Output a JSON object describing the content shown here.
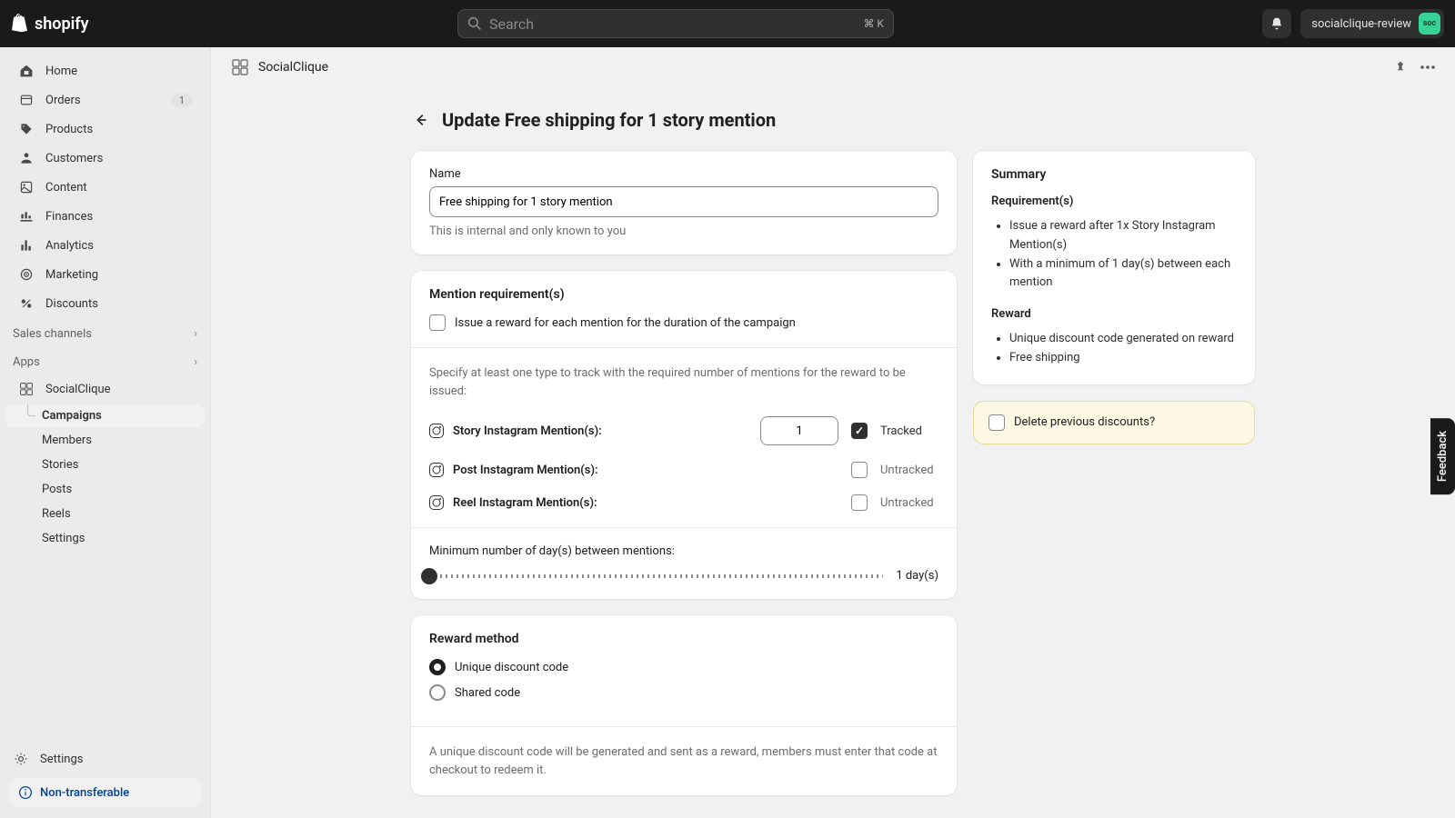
{
  "topbar": {
    "logo_text": "shopify",
    "search_placeholder": "Search",
    "search_shortcut": "⌘ K",
    "account_name": "socialclique-review",
    "avatar_initials": "soc"
  },
  "sidebar": {
    "items": [
      {
        "label": "Home",
        "icon": "home-icon"
      },
      {
        "label": "Orders",
        "icon": "orders-icon",
        "badge": "1"
      },
      {
        "label": "Products",
        "icon": "products-icon"
      },
      {
        "label": "Customers",
        "icon": "customers-icon"
      },
      {
        "label": "Content",
        "icon": "content-icon"
      },
      {
        "label": "Finances",
        "icon": "finances-icon"
      },
      {
        "label": "Analytics",
        "icon": "analytics-icon"
      },
      {
        "label": "Marketing",
        "icon": "marketing-icon"
      },
      {
        "label": "Discounts",
        "icon": "discounts-icon"
      }
    ],
    "sales_channels_label": "Sales channels",
    "apps_label": "Apps",
    "app_name": "SocialClique",
    "app_subitems": [
      "Campaigns",
      "Members",
      "Stories",
      "Posts",
      "Reels",
      "Settings"
    ],
    "settings_label": "Settings",
    "nontransferable_label": "Non-transferable"
  },
  "appbar": {
    "title": "SocialClique"
  },
  "page": {
    "title": "Update Free shipping for 1 story mention",
    "name_section": {
      "label": "Name",
      "value": "Free shipping for 1 story mention",
      "help": "This is internal and only known to you"
    },
    "mention_section": {
      "title": "Mention requirement(s)",
      "each_mention_label": "Issue a reward for each mention for the duration of the campaign",
      "specify_text": "Specify at least one type to track with the required number of mentions for the reward to be issued:",
      "story_label": "Story Instagram Mention(s):",
      "story_value": "1",
      "post_label": "Post Instagram Mention(s):",
      "reel_label": "Reel Instagram Mention(s):",
      "tracked_label": "Tracked",
      "untracked_label": "Untracked",
      "slider_label": "Minimum number of day(s) between mentions:",
      "slider_value": "1 day(s)"
    },
    "reward_section": {
      "title": "Reward method",
      "unique_label": "Unique discount code",
      "shared_label": "Shared code",
      "desc": "A unique discount code will be generated and sent as a reward, members must enter that code at checkout to redeem it."
    },
    "summary": {
      "title": "Summary",
      "req_label": "Requirement(s)",
      "req_items": [
        "Issue a reward after 1x Story Instagram Mention(s)",
        "With a minimum of 1 day(s) between each mention"
      ],
      "reward_label": "Reward",
      "reward_items": [
        "Unique discount code generated on reward",
        "Free shipping"
      ]
    },
    "delete_prev_label": "Delete previous discounts?"
  },
  "feedback_label": "Feedback"
}
